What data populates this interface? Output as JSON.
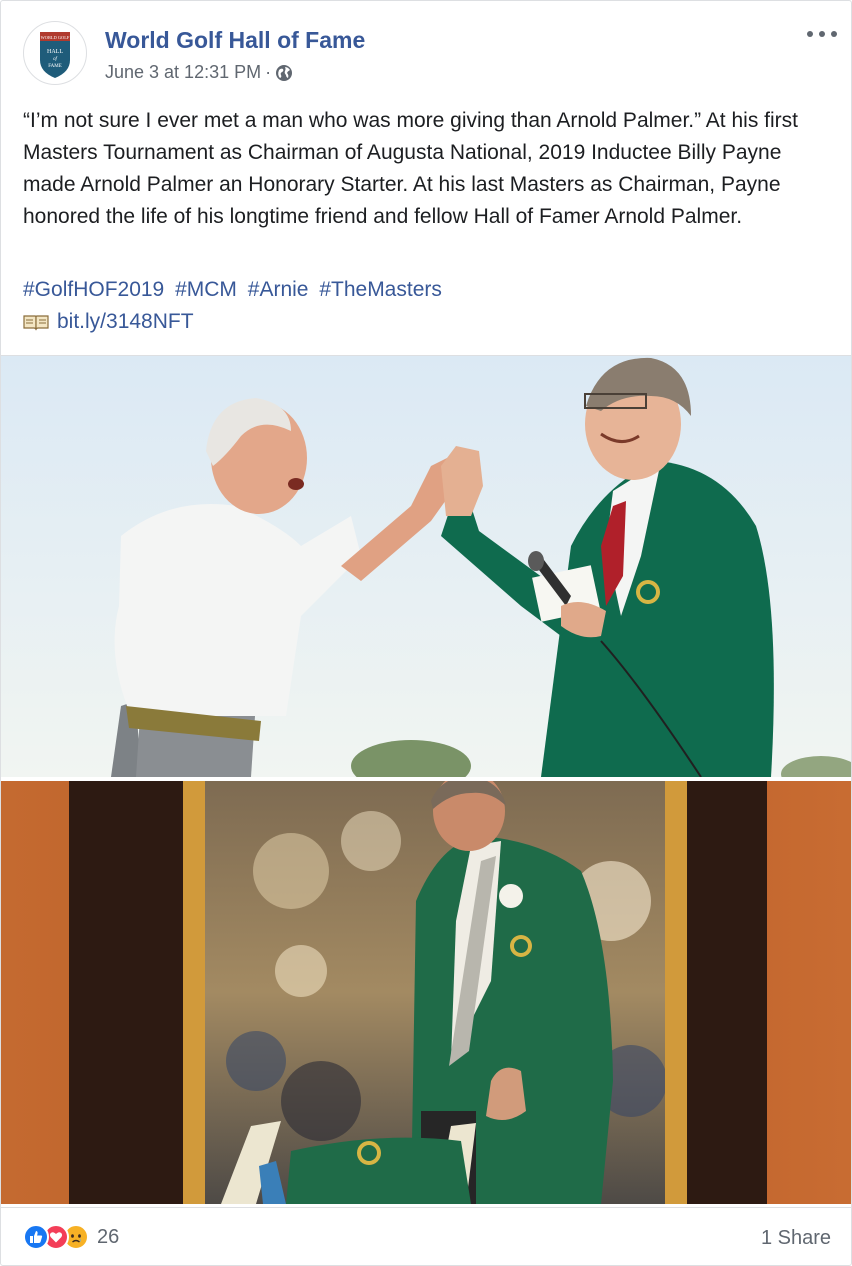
{
  "post": {
    "page_name": "World Golf Hall of Fame",
    "date": "June 3 at 12:31 PM",
    "meta_separator": "·",
    "privacy_icon": "globe-icon",
    "text": "“I’m not sure I ever met a man who was more giving than Arnold Palmer.” At his first Masters Tournament as Chairman of Augusta National, 2019 Inductee Billy Payne made Arnold Palmer an Honorary Starter. At his last Masters as Chairman, Payne honored the life of his longtime friend and fellow Hall of Famer Arnold Palmer.",
    "hashtags": [
      "#GolfHOF2019",
      "#MCM",
      "#Arnie",
      "#TheMasters"
    ],
    "link_icon": "open-book-icon",
    "link": "bit.ly/3148NFT"
  },
  "avatar": {
    "logo_lines": [
      "WORLD GOLF",
      "HALL",
      "of",
      "FAME"
    ]
  },
  "footer": {
    "reaction_icons": [
      "like-icon",
      "love-icon",
      "sad-icon"
    ],
    "reaction_count": "26",
    "shares": "1 Share"
  },
  "colors": {
    "link_blue": "#385898",
    "meta_gray": "#606770",
    "like_blue": "#1877f2",
    "love_red": "#f33e58",
    "sad_yellow": "#f7b125",
    "masters_green": "#0f6b4e"
  }
}
